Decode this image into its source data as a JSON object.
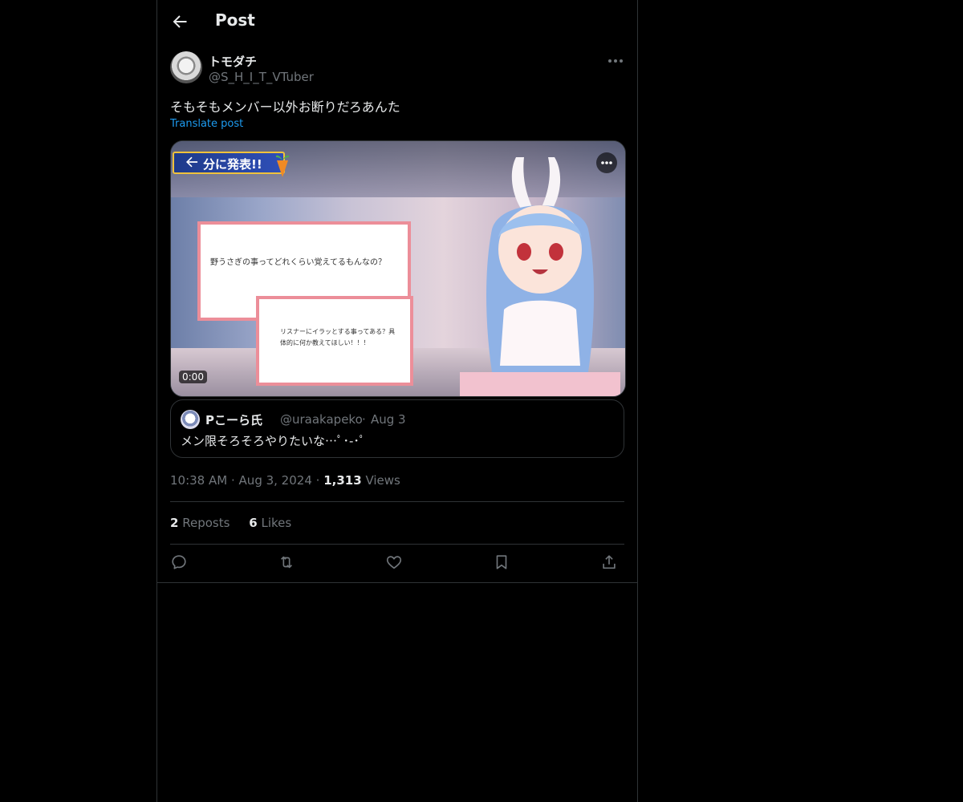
{
  "header": {
    "title": "Post",
    "back_icon": "arrow-left-icon"
  },
  "post": {
    "author": {
      "display_name": "トモダチ",
      "handle": "@S_H_I_T_VTuber"
    },
    "text": "そもそもメンバー以外お断りだろあんた",
    "translate_label": "Translate post",
    "media": {
      "banner_text": "分に発表!!",
      "card1_text": "野うさぎの事ってどれくらい覚えてるもんなの？",
      "card2_text": "リスナーにイラッとする事ってある？具体的に何か教えてほしい！！！",
      "timestamp": "0:00"
    },
    "quoted": {
      "display_name": "Pこーら氏",
      "handle": "@uraakapeko",
      "separator": "·",
      "date": "Aug 3",
      "text": "メン限そろそろやりたいな…ﾟ･-･ﾟ"
    },
    "meta": {
      "time": "10:38 AM",
      "sep1": "·",
      "date": "Aug 3, 2024",
      "sep2": "·",
      "views_count": "1,313",
      "views_label": "Views"
    },
    "stats": {
      "reposts_count": "2",
      "reposts_label": "Reposts",
      "likes_count": "6",
      "likes_label": "Likes"
    },
    "actions": [
      "reply-icon",
      "repost-icon",
      "like-icon",
      "bookmark-icon",
      "share-icon"
    ]
  },
  "colors": {
    "background": "#000000",
    "text": "#e7e9ea",
    "muted": "#71767b",
    "link": "#1d9bf0",
    "border": "#2f3336"
  }
}
